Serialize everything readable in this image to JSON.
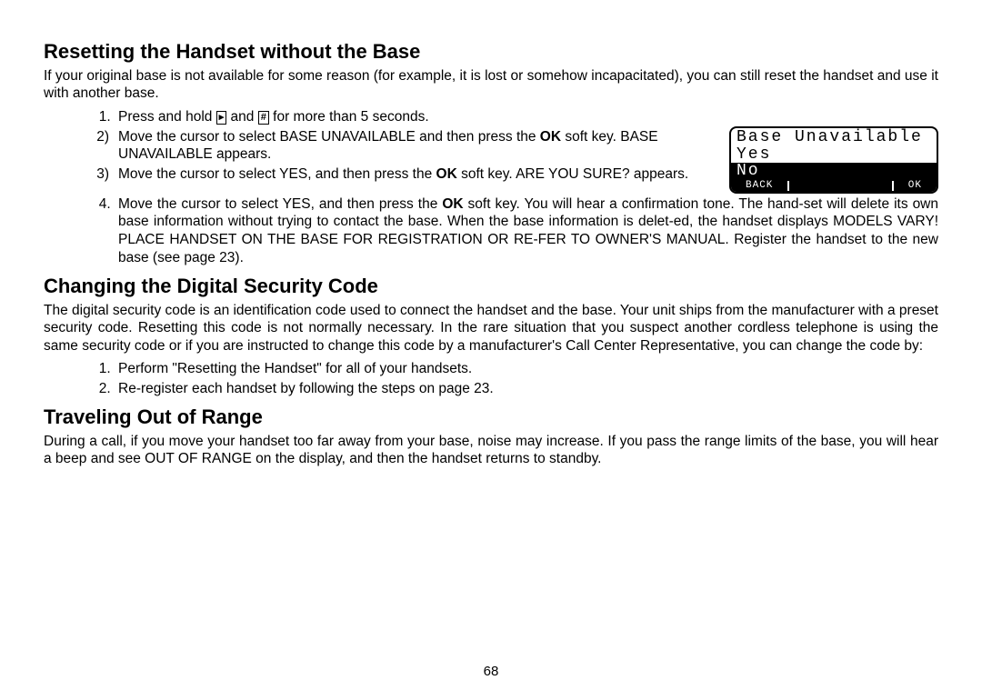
{
  "sec1": {
    "heading": "Resetting the Handset without the Base",
    "intro": "If your original base is not available for some reason (for example, it is lost or somehow incapacitated), you can still reset the handset and use it with another base.",
    "step1_a": "Press and hold ",
    "step1_icon1": "▸",
    "step1_b": " and ",
    "step1_icon2": "#",
    "step1_c": " for more than 5 seconds.",
    "step2_a": "Move the cursor to select BASE UNAVAILABLE and then press the ",
    "step2_bold": "OK",
    "step2_b": " soft key. BASE UNAVAILABLE appears.",
    "step3_a": "Move the cursor to select YES, and then press the ",
    "step3_bold": "OK",
    "step3_b": " soft key. ARE YOU SURE? appears.",
    "step4_a": "Move the cursor to select YES, and then press the ",
    "step4_bold": "OK",
    "step4_b": " soft key. You will hear a confirmation tone. The hand-set will delete its own base information without trying to contact the base. When the base information is delet-ed, the handset displays MODELS VARY! PLACE HANDSET ON THE BASE FOR REGISTRATION OR RE-FER TO OWNER'S MANUAL. Register the handset to the new base (see page 23)."
  },
  "lcd": {
    "title": "Base Unavailable",
    "opt1": "Yes",
    "opt2": "No",
    "sk_left": "BACK",
    "sk_right": "OK"
  },
  "sec2": {
    "heading": "Changing the Digital Security Code",
    "intro": "The digital security code is an identification code used to connect the handset and the base. Your unit ships from the manufacturer with a preset security code. Resetting this code is not normally necessary. In the rare situation that you suspect another cordless telephone is using the same security code or if you are instructed to change this code by a manufacturer's Call Center Representative, you can change the code by:",
    "step1": "Perform \"Resetting the Handset\" for all of your handsets.",
    "step2": "Re-register each handset by following the steps on page 23."
  },
  "sec3": {
    "heading": "Traveling Out of Range",
    "body": "During a call, if you move your handset too far away from your base, noise may increase. If you pass the range limits of the base, you will hear a beep and see OUT OF RANGE on the display, and then the handset returns to standby."
  },
  "page_number": "68"
}
